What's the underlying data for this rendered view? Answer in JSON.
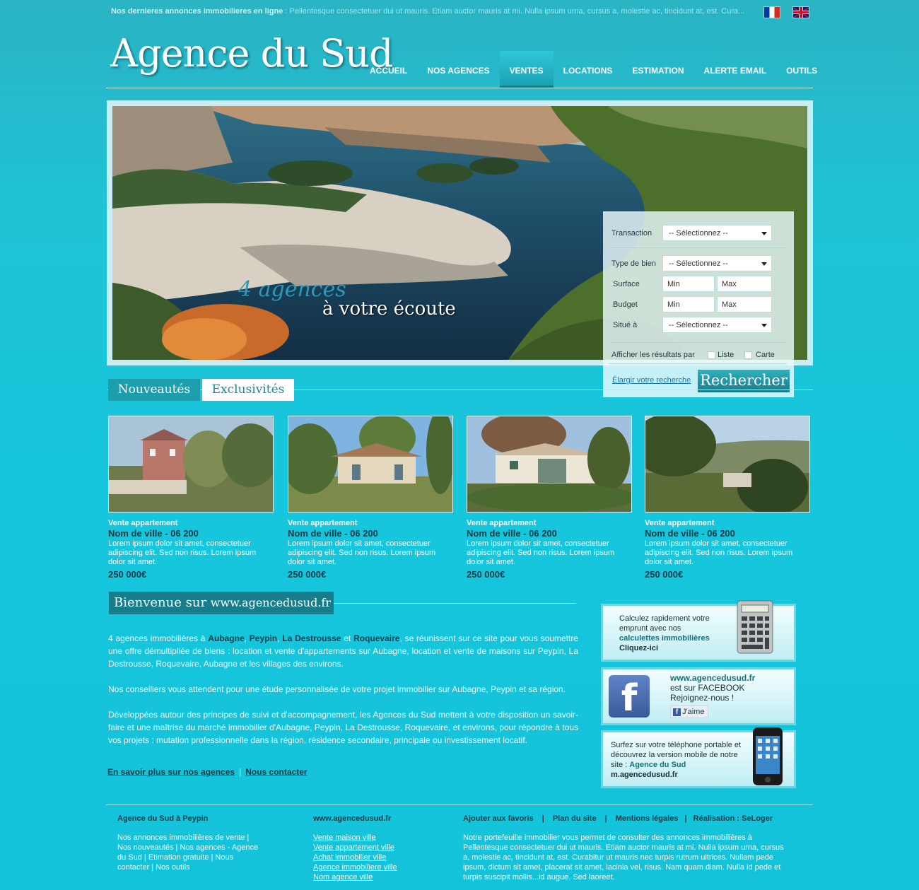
{
  "ticker": {
    "label": "Nos dernieres annonces immobilieres en ligne",
    "sep": " : ",
    "text": "Pellentesque consectetuer dui ut mauris. Etiam auctor mauris at mi. Nulla ipsum urna, cursus a, molestie ac, tincidunt at, est. Cura..."
  },
  "logo": "Agence du Sud",
  "nav": [
    "ACCUEIL",
    "NOS AGENCES",
    "VENTES",
    "LOCATIONS",
    "ESTIMATION",
    "ALERTE EMAIL",
    "OUTILS"
  ],
  "nav_active": "VENTES",
  "hero": {
    "slogan1": "4 agences",
    "slogan2": "à votre écoute"
  },
  "search": {
    "transaction_label": "Transaction",
    "type_label": "Type de bien",
    "surface_label": "Surface",
    "budget_label": "Budget",
    "situe_label": "Situé à",
    "select_placeholder": "-- Sélectionnez --",
    "min": "Min",
    "max": "Max",
    "afficher_label": "Afficher les résultats par",
    "liste": "Liste",
    "carte": "Carte",
    "elargir": "Élargir votre recherche",
    "button": "Rechercher"
  },
  "tabs": [
    "Nouveautés",
    "Exclusivités"
  ],
  "listings": [
    {
      "type": "Vente appartement",
      "city": "Nom de ville - 06 200",
      "desc": "Lorem ipsum dolor sit amet, consectetuer adipiscing elit. Sed non risus. Lorem ipsum dolor sit amet.",
      "price": "250 000€"
    },
    {
      "type": "Vente appartement",
      "city": "Nom de ville - 06 200",
      "desc": "Lorem ipsum dolor sit amet, consectetuer adipiscing elit. Sed non risus. Lorem ipsum dolor sit amet.",
      "price": "250 000€"
    },
    {
      "type": "Vente appartement",
      "city": "Nom de ville - 06 200",
      "desc": "Lorem ipsum dolor sit amet, consectetuer adipiscing elit. Sed non risus. Lorem ipsum dolor sit amet.",
      "price": "250 000€"
    },
    {
      "type": "Vente appartement",
      "city": "Nom de ville - 06 200",
      "desc": "Lorem ipsum dolor sit amet, consectetuer adipiscing elit. Sed non risus. Lorem ipsum dolor sit amet.",
      "price": "250 000€"
    }
  ],
  "welcome": {
    "title_a": "Bienvenue sur ",
    "title_b": "www.agencedusud.fr",
    "p1_a": "4 agences immobilières à ",
    "town1": "Aubagne",
    "c1": ", ",
    "town2": "Peypin",
    "c2": ", ",
    "town3": "La Destrousse",
    "c3": " et ",
    "town4": "Roquevaire",
    "p1_b": ", se réunissent sur ce site pour vous soumettre une offre démultipliée de biens : location et  vente d'appartements sur Aubagne, location et vente de maisons sur Peypin, La Destrousse, Roquevaire, Aubagne et les villages des environs.",
    "p2": "Nos conseillers vous attendent pour une étude personnalisée de votre projet immobilier sur Aubagne, Peypin et sa région.",
    "p3": "Développées autour des principes de suivi et d'accompagnement, les Agences du Sud mettent à votre disposition un savoir-faire et une maîtrise du marché immobilier d'Aubagne, Peypin, La Destrousse, Roquevaire, et environs, pour répondre à tous vos projets : mutation professionnelle dans la région, résidence secondaire, principale ou investissement locatif.",
    "link1": "En savoir plus sur nos agences",
    "link_sep": "|",
    "link2": "Nous contacter"
  },
  "side": {
    "calc": {
      "l1": "Calculez rapidement votre",
      "l2": "emprunt avec nos",
      "l3": "calculettes immobilières",
      "l4": "Cliquez-ici"
    },
    "fb": {
      "l1": "www.agencedusud.fr",
      "l2": "est sur FACEBOOK",
      "l3": "Rejoignez-nous !",
      "like": "J'aime"
    },
    "mobile": {
      "l1": "Surfez sur votre téléphone portable et",
      "l2": "découvrez la version mobile de notre",
      "l3a": "site : ",
      "l3b": "Agence du Sud",
      "l4": "m.agencedusud.fr"
    }
  },
  "footer": {
    "col1_title": "Agence du Sud à Peypin",
    "col1_text": "Nos annonces immobilières de vente | Nos nouveautés | Nos agences - Agence du Sud | Etimation gratuite | Nous contacter | Nos outils",
    "col2_title": "www.agencedusud.fr",
    "col2_links": [
      "Vente maison ville",
      "Vente appartement ville",
      "Achat immobilier ville",
      "Agence immobiliere ville",
      "Nom agence ville"
    ],
    "col3_links": [
      "Ajouter aux favoris",
      "Plan du site",
      "Mentions légales",
      "Réalisation : SeLoger"
    ],
    "col3_sep": "|",
    "col3_text": "Notre portefeuille immobilier vous permet de consulter des annonces immobilières à Pellentesque consectetuer dui ut mauris. Etiam auctor mauris at mi. Nulla ipsum urna, cursus a, molestie ac, tincidunt at, est. Curabitur ut mauris nec turpis rutrum ultrices. Nullam pede ipsum, dictum sit amet, placerat sit amet, lacinia vel, risus. Nam quam diam. Nulla id pede et turpis suscipit mollis...id augue. Sed laoreet."
  }
}
